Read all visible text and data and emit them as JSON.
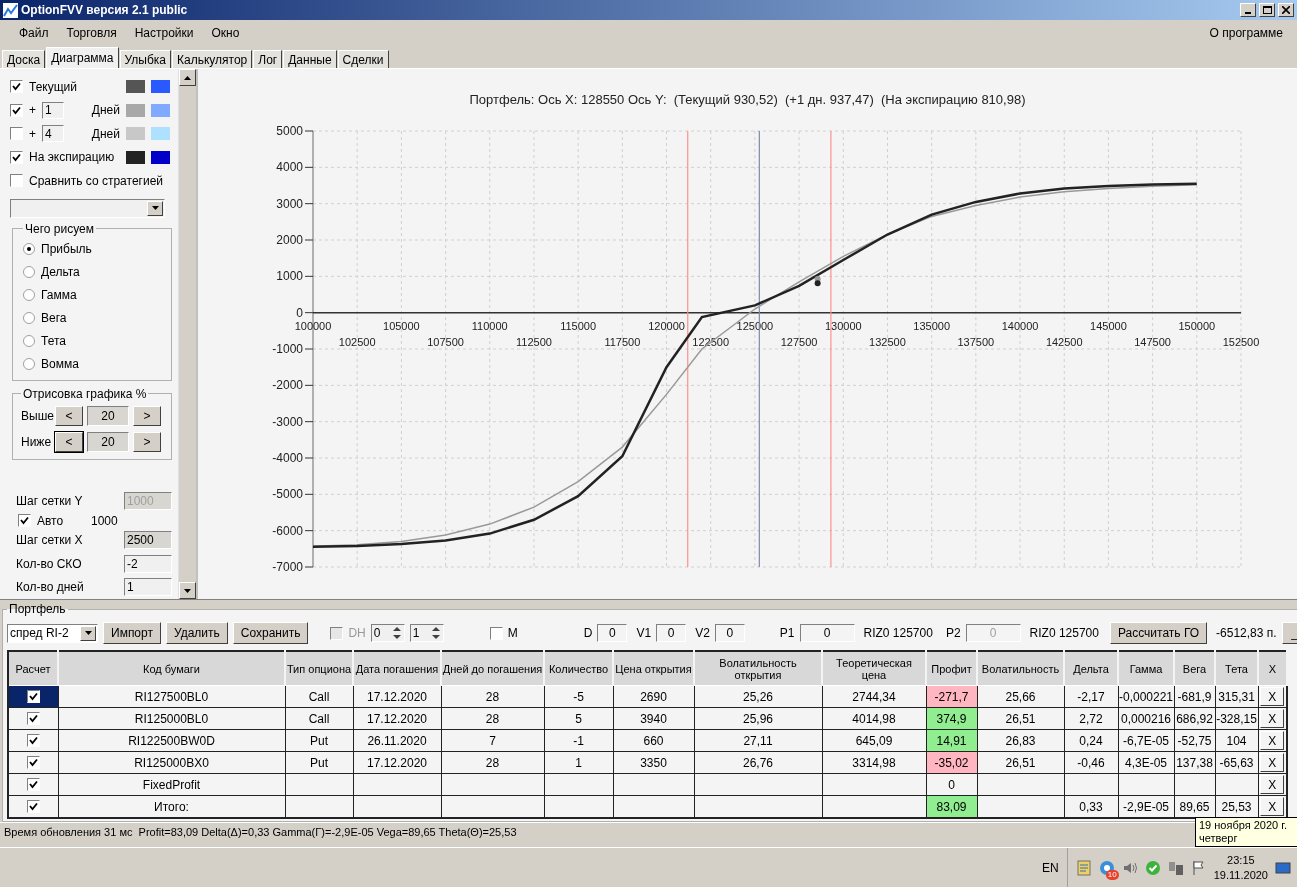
{
  "window": {
    "title": "OptionFVV версия 2.1 public"
  },
  "menu": {
    "items": [
      "Файл",
      "Торговля",
      "Настройки",
      "Окно"
    ],
    "about": "О программе"
  },
  "tabs": [
    {
      "label": "Доска",
      "selected": false
    },
    {
      "label": "Диаграмма",
      "selected": true
    },
    {
      "label": "Улыбка",
      "selected": false
    },
    {
      "label": "Калькулятор",
      "selected": false
    },
    {
      "label": "Лог",
      "selected": false
    },
    {
      "label": "Данные",
      "selected": false
    },
    {
      "label": "Сделки",
      "selected": false
    }
  ],
  "curves": [
    {
      "kind": "fixed",
      "checked": true,
      "label": "Текущий",
      "swatches": [
        {
          "color": "#555555"
        },
        {
          "color": "#2a5aff"
        }
      ]
    },
    {
      "kind": "days",
      "checked": true,
      "prefix": "+",
      "days": "1",
      "unit": "Дней",
      "swatches": [
        {
          "color": "#a8a8a8"
        },
        {
          "color": "#7faaff"
        }
      ]
    },
    {
      "kind": "days",
      "checked": false,
      "prefix": "+",
      "days": "4",
      "unit": "Дней",
      "swatches": [
        {
          "color": "#c8c8c8"
        },
        {
          "color": "#aee0ff"
        }
      ]
    },
    {
      "kind": "fixed",
      "checked": true,
      "label": "На экспирацию",
      "swatches": [
        {
          "color": "#222222"
        },
        {
          "color": "#0000c8"
        }
      ]
    }
  ],
  "compare": {
    "checked": false,
    "label": "Сравнить со стратегией"
  },
  "draw_group": {
    "title": "Чего рисуем",
    "options": [
      {
        "label": "Прибыль",
        "selected": true
      },
      {
        "label": "Дельта",
        "selected": false
      },
      {
        "label": "Гамма",
        "selected": false
      },
      {
        "label": "Вега",
        "selected": false
      },
      {
        "label": "Тета",
        "selected": false
      },
      {
        "label": "Вомма",
        "selected": false
      }
    ]
  },
  "range_group": {
    "title": "Отрисовка графика %",
    "rows": [
      {
        "label": "Выше",
        "dec": "<",
        "value": "20",
        "inc": ">",
        "focused": false
      },
      {
        "label": "Ниже",
        "dec": "<",
        "value": "20",
        "inc": ">",
        "focused": true
      }
    ]
  },
  "grid_settings": [
    {
      "kind": "field",
      "label": "Шаг сетки Y",
      "value": "1000",
      "disabled": true,
      "readonly": true
    },
    {
      "kind": "check",
      "label": "Авто",
      "checked": true,
      "value": "1000"
    },
    {
      "kind": "field",
      "label": "Шаг сетки X",
      "value": "2500",
      "disabled": false,
      "readonly": true
    },
    {
      "kind": "field",
      "label": "Кол-во СКО",
      "value": "-2",
      "disabled": false,
      "readonly": false
    },
    {
      "kind": "field",
      "label": "Кол-во дней",
      "value": "1",
      "disabled": false,
      "readonly": false
    }
  ],
  "chart": {
    "title": "Портфель: Ось X: 128550 Ось Y:  (Текущий 930,52)  (+1 дн. 937,47)  (На экспирацию 810,98)",
    "minor_labels": [
      "102500",
      "107500",
      "112500",
      "117500",
      "122500",
      "127500",
      "132500",
      "137500",
      "142500",
      "147500",
      "152500"
    ],
    "chart_data": {
      "type": "line",
      "x": [
        100000,
        102500,
        105000,
        107500,
        110000,
        112500,
        115000,
        117500,
        120000,
        122000,
        125000,
        127500,
        130000,
        132500,
        135000,
        137500,
        140000,
        142500,
        145000,
        147500,
        150000
      ],
      "series": [
        {
          "color": "#999999",
          "values": [
            -6430,
            -6390,
            -6300,
            -6120,
            -5820,
            -5350,
            -4650,
            -3700,
            -2250,
            -1000,
            100,
            850,
            1550,
            2150,
            2650,
            2950,
            3180,
            3330,
            3420,
            3480,
            3520
          ]
        },
        {
          "color": "#222222",
          "values": [
            -6440,
            -6420,
            -6370,
            -6270,
            -6080,
            -5700,
            -5050,
            -3950,
            -1500,
            -120,
            200,
            740,
            1450,
            2150,
            2700,
            3050,
            3280,
            3420,
            3490,
            3530,
            3550
          ]
        }
      ],
      "xlim": [
        100000,
        152500
      ],
      "ylim": [
        -7000,
        5000
      ],
      "grid": true,
      "ref_lines": [
        {
          "axis": "x",
          "value": 121200,
          "color": "#ff9090"
        },
        {
          "axis": "x",
          "value": 125250,
          "color": "#8088a8"
        },
        {
          "axis": "x",
          "value": 129300,
          "color": "#ff9090"
        }
      ],
      "xticks": [
        100000,
        105000,
        110000,
        115000,
        120000,
        125000,
        130000,
        135000,
        140000,
        145000,
        150000
      ],
      "yticks": [
        -7000,
        -6000,
        -5000,
        -4000,
        -3000,
        -2000,
        -1000,
        0,
        1000,
        2000,
        3000,
        4000,
        5000
      ]
    }
  },
  "portfolio": {
    "title": "Портфель",
    "strategy": "спред RI-2",
    "buttons": [
      "Импорт",
      "Удалить",
      "Сохранить"
    ],
    "dh": {
      "label": "DH",
      "checked": false,
      "disabled": true
    },
    "spinners": [
      "0",
      "1"
    ],
    "m": {
      "label": "M",
      "checked": false
    },
    "items": [
      {
        "kind": "field",
        "label": "D",
        "value": "0",
        "disabled": false
      },
      {
        "kind": "field",
        "label": "V1",
        "value": "0",
        "disabled": false
      },
      {
        "kind": "field",
        "label": "V2",
        "value": "0",
        "disabled": false
      },
      {
        "kind": "field",
        "label": "P1",
        "value": "0",
        "disabled": false
      },
      {
        "kind": "text",
        "label": "RIZ0 125700"
      },
      {
        "kind": "field",
        "label": "P2",
        "value": "0",
        "disabled": true
      },
      {
        "kind": "text",
        "label": "RIZ0 125700"
      }
    ],
    "calc_button": "Рассчитать ГО",
    "go_value": "-6512,83 п.",
    "collapse": "_"
  },
  "table": {
    "columns": [
      "Расчет",
      "Код бумаги",
      "Тип опциона",
      "Дата погашения",
      "Дней до погашения",
      "Количество",
      "Цена открытия",
      "Волатильность открытия",
      "Теоретическая цена",
      "Профит",
      "Волатильность",
      "Дельта",
      "Гамма",
      "Вега",
      "Тета",
      "X"
    ],
    "rows": [
      {
        "checked": true,
        "selected": true,
        "cells": [
          "",
          "RI127500BL0",
          "Call",
          "17.12.2020",
          "28",
          "-5",
          "2690",
          "25,26",
          "2744,34",
          "-271,7",
          "25,66",
          "-2,17",
          "-0,000221",
          "-681,9",
          "315,31",
          "X"
        ],
        "color": "#ffb6c1"
      },
      {
        "checked": true,
        "selected": false,
        "cells": [
          "",
          "RI125000BL0",
          "Call",
          "17.12.2020",
          "28",
          "5",
          "3940",
          "25,96",
          "4014,98",
          "374,9",
          "26,51",
          "2,72",
          "0,000216",
          "686,92",
          "-328,15",
          "X"
        ],
        "color": "#90ee90"
      },
      {
        "checked": true,
        "selected": false,
        "cells": [
          "",
          "RI122500BW0D",
          "Put",
          "26.11.2020",
          "7",
          "-1",
          "660",
          "27,11",
          "645,09",
          "14,91",
          "26,83",
          "0,24",
          "-6,7E-05",
          "-52,75",
          "104",
          "X"
        ],
        "color": "#90ee90"
      },
      {
        "checked": true,
        "selected": false,
        "cells": [
          "",
          "RI125000BX0",
          "Put",
          "17.12.2020",
          "28",
          "1",
          "3350",
          "26,76",
          "3314,98",
          "-35,02",
          "26,51",
          "-0,46",
          "4,3E-05",
          "137,38",
          "-65,63",
          "X"
        ],
        "color": "#ffb6c1"
      },
      {
        "checked": true,
        "selected": false,
        "cells": [
          "",
          "FixedProfit",
          "",
          "",
          "",
          "",
          "",
          "",
          "",
          "0",
          "",
          "",
          "",
          "",
          "",
          "X"
        ]
      },
      {
        "checked": true,
        "selected": false,
        "cells": [
          "",
          "Итого:",
          "",
          "",
          "",
          "",
          "",
          "",
          "",
          "83,09",
          "",
          "0,33",
          "-2,9E-05",
          "89,65",
          "25,53",
          "X"
        ],
        "color": "#90ee90"
      }
    ]
  },
  "status_bar": "Время обновления 31 мс  Profit=83,09 Delta(Δ)=0,33 Gamma(Γ)=-2,9E-05 Vega=89,65 Theta(Θ)=25,53",
  "tooltip": {
    "lines": [
      "19 ноября 2020 г.",
      "четверг"
    ]
  },
  "taskbar": {
    "language": "EN",
    "badge": "10",
    "time": "23:15",
    "date": "19.11.2020"
  }
}
